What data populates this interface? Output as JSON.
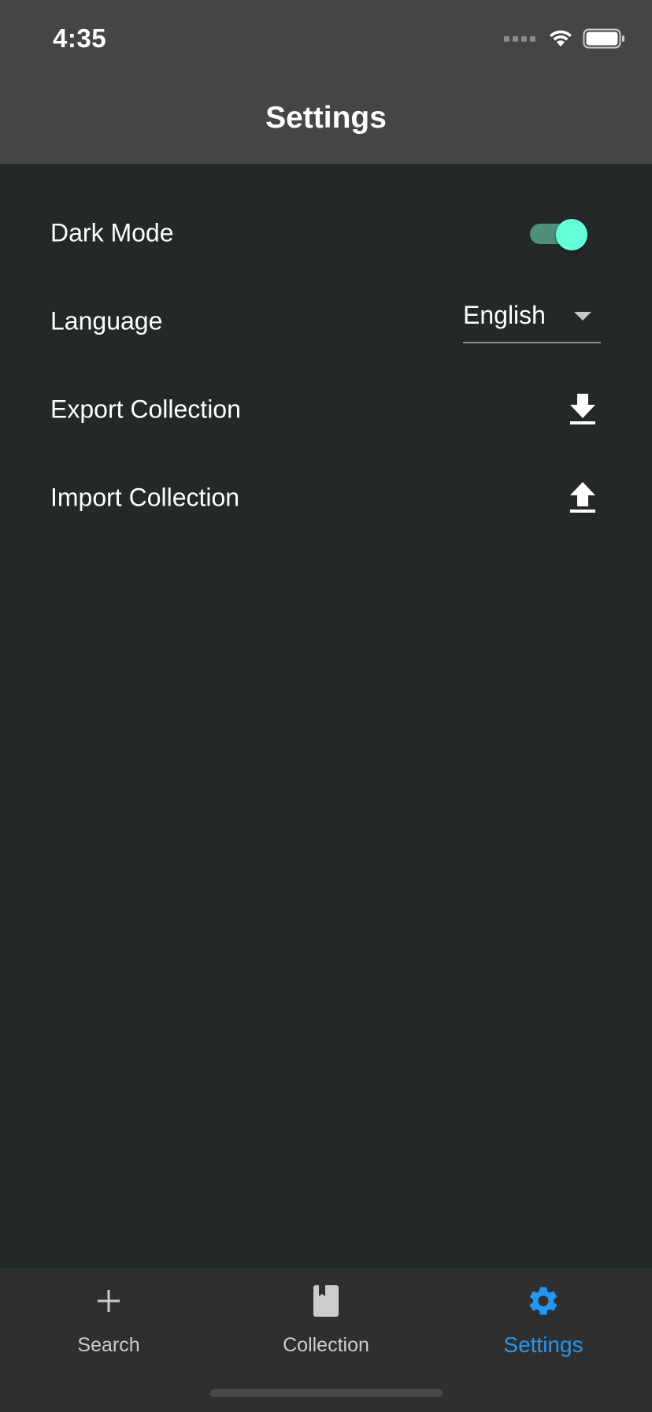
{
  "status_bar": {
    "time": "4:35"
  },
  "header": {
    "title": "Settings"
  },
  "settings": {
    "dark_mode": {
      "label": "Dark Mode",
      "enabled": true
    },
    "language": {
      "label": "Language",
      "value": "English"
    },
    "export": {
      "label": "Export Collection",
      "icon": "download-icon"
    },
    "import": {
      "label": "Import Collection",
      "icon": "upload-icon"
    }
  },
  "tabs": [
    {
      "label": "Search",
      "icon": "plus-icon",
      "active": false
    },
    {
      "label": "Collection",
      "icon": "book-icon",
      "active": false
    },
    {
      "label": "Settings",
      "icon": "gear-icon",
      "active": true
    }
  ],
  "colors": {
    "header_bg": "#454545",
    "body_bg": "#232828",
    "tab_bar_bg": "#2f2f2f",
    "accent": "#2196f3",
    "toggle_thumb": "#64ffda",
    "toggle_track": "#4f8f7c"
  }
}
